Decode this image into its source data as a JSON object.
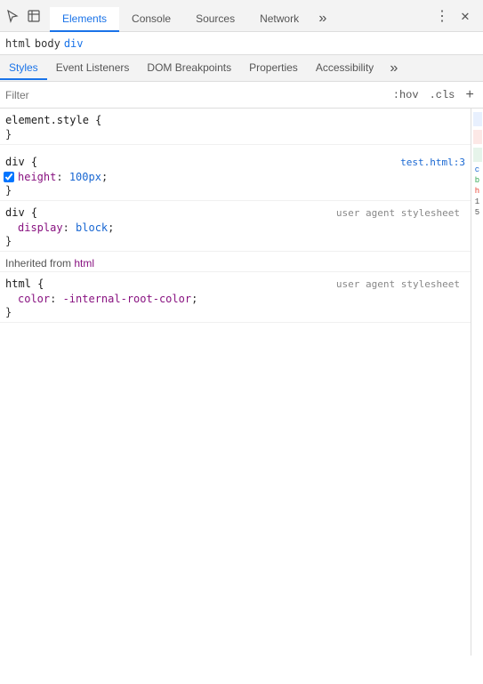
{
  "toolbar": {
    "icons": [
      {
        "name": "cursor-icon",
        "symbol": "⊹",
        "interactable": true
      },
      {
        "name": "inspect-icon",
        "symbol": "⬜",
        "interactable": true
      }
    ]
  },
  "main_tabs": [
    {
      "id": "elements",
      "label": "Elements",
      "active": true
    },
    {
      "id": "console",
      "label": "Console",
      "active": false
    },
    {
      "id": "sources",
      "label": "Sources",
      "active": false
    },
    {
      "id": "network",
      "label": "Network",
      "active": false
    }
  ],
  "main_tab_more": "»",
  "tab_actions": {
    "kebab": "⋮",
    "close": "✕"
  },
  "breadcrumbs": [
    {
      "label": "html",
      "active": false
    },
    {
      "label": "body",
      "active": false
    },
    {
      "label": "div",
      "active": true
    }
  ],
  "subtabs": [
    {
      "id": "styles",
      "label": "Styles",
      "active": true
    },
    {
      "id": "event-listeners",
      "label": "Event Listeners",
      "active": false
    },
    {
      "id": "dom-breakpoints",
      "label": "DOM Breakpoints",
      "active": false
    },
    {
      "id": "properties",
      "label": "Properties",
      "active": false
    },
    {
      "id": "accessibility",
      "label": "Accessibility",
      "active": false
    }
  ],
  "subtab_more": "»",
  "filter": {
    "placeholder": "Filter",
    "hov_label": ":hov",
    "cls_label": ".cls",
    "plus_label": "+"
  },
  "rules": [
    {
      "id": "element-style",
      "selector": "element.style {",
      "source": null,
      "properties": [],
      "close_brace": "}",
      "type": "element"
    },
    {
      "id": "div-rule-1",
      "selector": "div {",
      "source": "test.html:3",
      "properties": [
        {
          "checked": true,
          "name": "height",
          "value": "100px",
          "strikethrough": false
        }
      ],
      "close_brace": "}",
      "type": "user",
      "has_more": true
    },
    {
      "id": "div-rule-2",
      "selector": "div {",
      "source": "user agent stylesheet",
      "properties": [
        {
          "checked": null,
          "name": "display",
          "value": "block",
          "strikethrough": false
        }
      ],
      "close_brace": "}",
      "type": "user-agent"
    },
    {
      "id": "inherited",
      "type": "inherited",
      "label": "Inherited from",
      "tag": "html"
    },
    {
      "id": "html-rule",
      "selector": "html {",
      "source": "user agent stylesheet",
      "properties": [
        {
          "checked": null,
          "name": "color",
          "value": "-internal-root-color",
          "strikethrough": false
        }
      ],
      "close_brace": "}",
      "type": "user-agent"
    }
  ],
  "right_panel": {
    "bars": [
      {
        "color": "#e8f0fe",
        "label": ""
      },
      {
        "color": "#fce8e6",
        "label": ""
      },
      {
        "color": "#e6f4ea",
        "label": ""
      }
    ],
    "partial_items": [
      {
        "text": "c",
        "color": "#1967d2"
      },
      {
        "text": "b",
        "color": "#34a853"
      },
      {
        "text": "h",
        "color": "#ea4335"
      },
      {
        "text": "1",
        "color": "#555"
      },
      {
        "text": "5",
        "color": "#555"
      }
    ]
  }
}
